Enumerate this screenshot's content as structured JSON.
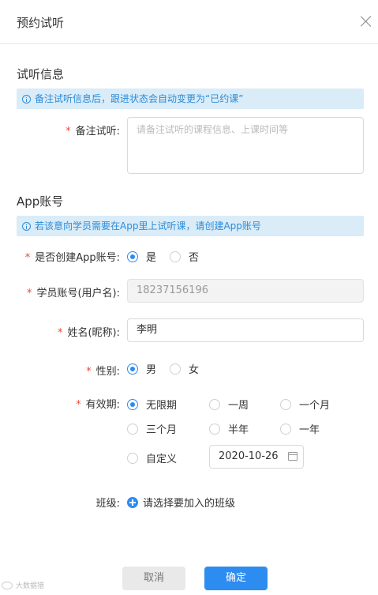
{
  "dialog": {
    "title": "预约试听"
  },
  "trial_section": {
    "title": "试听信息",
    "notice": "备注试听信息后，跟进状态会自动变更为“已约课”",
    "remark_label": "备注试听:",
    "remark_placeholder": "请备注试听的课程信息、上课时间等"
  },
  "app_section": {
    "title": "App账号",
    "notice": "若该意向学员需要在App里上试听课，请创建App账号",
    "create_label": "是否创建App账号:",
    "create_options": [
      "是",
      "否"
    ],
    "create_selected": "是",
    "account_label": "学员账号(用户名):",
    "account_value": "18237156196",
    "name_label": "姓名(昵称):",
    "name_value": "李明",
    "gender_label": "性别:",
    "gender_options": [
      "男",
      "女"
    ],
    "gender_selected": "男",
    "validity_label": "有效期:",
    "validity_options": [
      "无限期",
      "一周",
      "一个月",
      "三个月",
      "半年",
      "一年",
      "自定义"
    ],
    "validity_selected": "无限期",
    "custom_date": "2020-10-26",
    "class_label": "班级:",
    "class_add_text": "请选择要加入的班级"
  },
  "footer": {
    "cancel_label": "取消",
    "ok_label": "确定"
  },
  "watermark": "大数据猎",
  "colors": {
    "accent": "#2d8cf0",
    "notice_bg": "#d9ecf8",
    "required": "#e8483b"
  }
}
